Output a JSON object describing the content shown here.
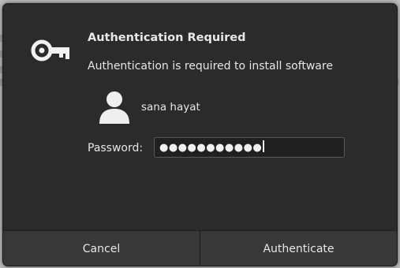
{
  "dialog": {
    "title": "Authentication Required",
    "message": "Authentication is required to install software",
    "user": {
      "name": "sana hayat",
      "icon": "user-avatar-icon"
    },
    "password": {
      "label": "Password:",
      "masked_value": "●●●●●●●●●●●",
      "char_count": 11
    },
    "buttons": {
      "cancel": "Cancel",
      "authenticate": "Authenticate"
    },
    "icons": {
      "header": "key-icon"
    }
  },
  "colors": {
    "dialog_bg": "#2b2b2b",
    "button_bg": "#383838",
    "text": "#e6e6e6"
  }
}
